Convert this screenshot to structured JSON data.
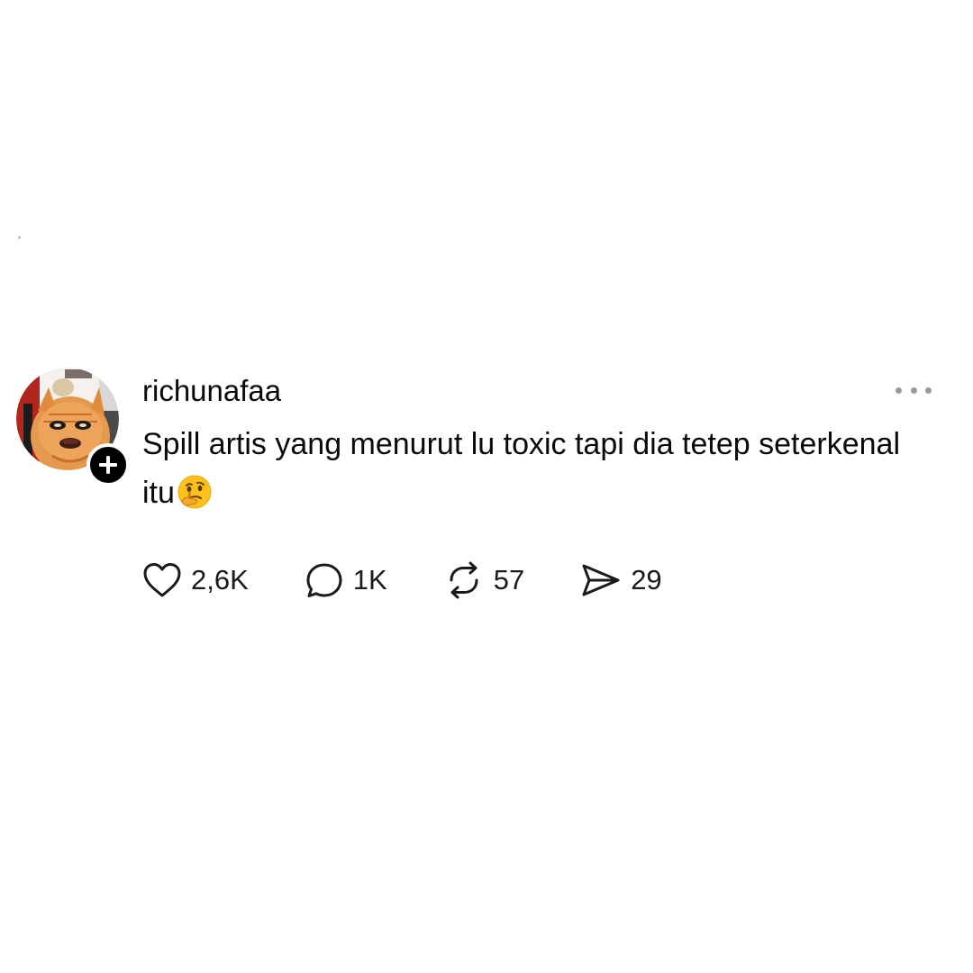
{
  "post": {
    "username": "richunafaa",
    "text": "Spill artis yang menurut lu toxic tapi dia tetep seterkenal itu",
    "emoji": "thinking-face-emoji",
    "follow_icon": "plus-icon",
    "more_icon": "more-horizontal-icon"
  },
  "actions": {
    "likes": {
      "icon": "heart-icon",
      "count": "2,6K"
    },
    "replies": {
      "icon": "comment-icon",
      "count": "1K"
    },
    "reposts": {
      "icon": "repost-icon",
      "count": "57"
    },
    "shares": {
      "icon": "send-icon",
      "count": "29"
    }
  },
  "colors": {
    "background": "#ffffff",
    "text": "#0a0a0a",
    "muted": "#9a9a9a",
    "badge": "#000000"
  }
}
